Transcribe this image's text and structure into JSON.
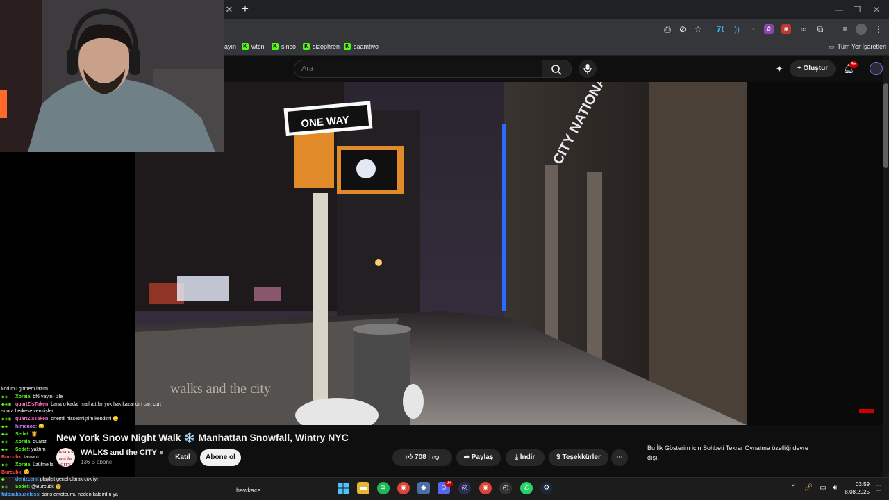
{
  "browser": {
    "bookmarks": [
      {
        "label": "ayın",
        "kick": false
      },
      {
        "label": "wtcn",
        "kick": true
      },
      {
        "label": "sinco",
        "kick": true
      },
      {
        "label": "sizophren",
        "kick": true
      },
      {
        "label": "saamtwo",
        "kick": true
      }
    ],
    "all_bookmarks_label": "Tüm Yer İşaretleri"
  },
  "youtube": {
    "search_placeholder": "Ara",
    "create_label": "Oluştur",
    "notification_badge": "9+"
  },
  "video": {
    "sign_text": "ONE WAY",
    "building_sign": "CITY NATIONAL",
    "watermark": "walks and the city",
    "title": "New York Snow Night Walk ❄️ Manhattan Snowfall, Wintry NYC",
    "channel_name": "WALKS and the CITY",
    "channel_avatar_text": "WALKS and the CITY",
    "subscribers": "136 B abone",
    "join_label": "Katıl",
    "subscribe_label": "Abone ol",
    "like_count": "708",
    "share_label": "Paylaş",
    "download_label": "İndir",
    "thanks_label": "Teşekkürler",
    "replay_note": "Bu İlk Gösterim için Sohbeti Tekrar Oynatma özelliği devre dışı."
  },
  "chat": [
    {
      "user": "",
      "text": "kod mu girmem lazım",
      "color": "#ffffff"
    },
    {
      "user": "Xoraia",
      "text": ": bf6 yayını izle",
      "color": "#53fc18"
    },
    {
      "user": "quartZisTaken",
      "text": ": bana o kadar mail attılar yok hak kazandın cart curt",
      "color": "#ff6ec7"
    },
    {
      "user": "",
      "text": "sonra herkese vermişler",
      "color": "#ffffff"
    },
    {
      "user": "quartZisTaken",
      "text": ": önemli hissetmiştim kendimi 😞",
      "color": "#ff6ec7"
    },
    {
      "user": "himenoo",
      "text": ": 😞",
      "color": "#c084fc"
    },
    {
      "user": "Sedef",
      "text": ": 👸",
      "color": "#53fc18"
    },
    {
      "user": "Xoraia",
      "text": ": quartz",
      "color": "#53fc18"
    },
    {
      "user": "Sedef",
      "text": ": yaktım",
      "color": "#53fc18"
    },
    {
      "user": "Burcubk",
      "text": ": tamam",
      "color": "#ff4d4d"
    },
    {
      "user": "Xoraia",
      "text": ": üzülme la",
      "color": "#53fc18"
    },
    {
      "user": "Burcubk",
      "text": ": 😊",
      "color": "#ff4d4d"
    },
    {
      "user": "denizcem",
      "text": ": playlist genel olarak cok iyi",
      "color": "#4da6ff"
    },
    {
      "user": "Sedef",
      "text": ": @Burcubk 😊",
      "color": "#53fc18"
    },
    {
      "user": "fatosakauseless",
      "text": ": dans emoteumu neden kaldırdın ya",
      "color": "#4da6ff"
    }
  ],
  "taskbar": {
    "search_text": "hawkace",
    "discord_badge": "9+",
    "time": "03:59",
    "date": "8.08.2025"
  },
  "colors": {
    "accent_kick": "#53fc18",
    "notification_red": "#cc0000",
    "yt_bg": "#0f0f0f"
  }
}
